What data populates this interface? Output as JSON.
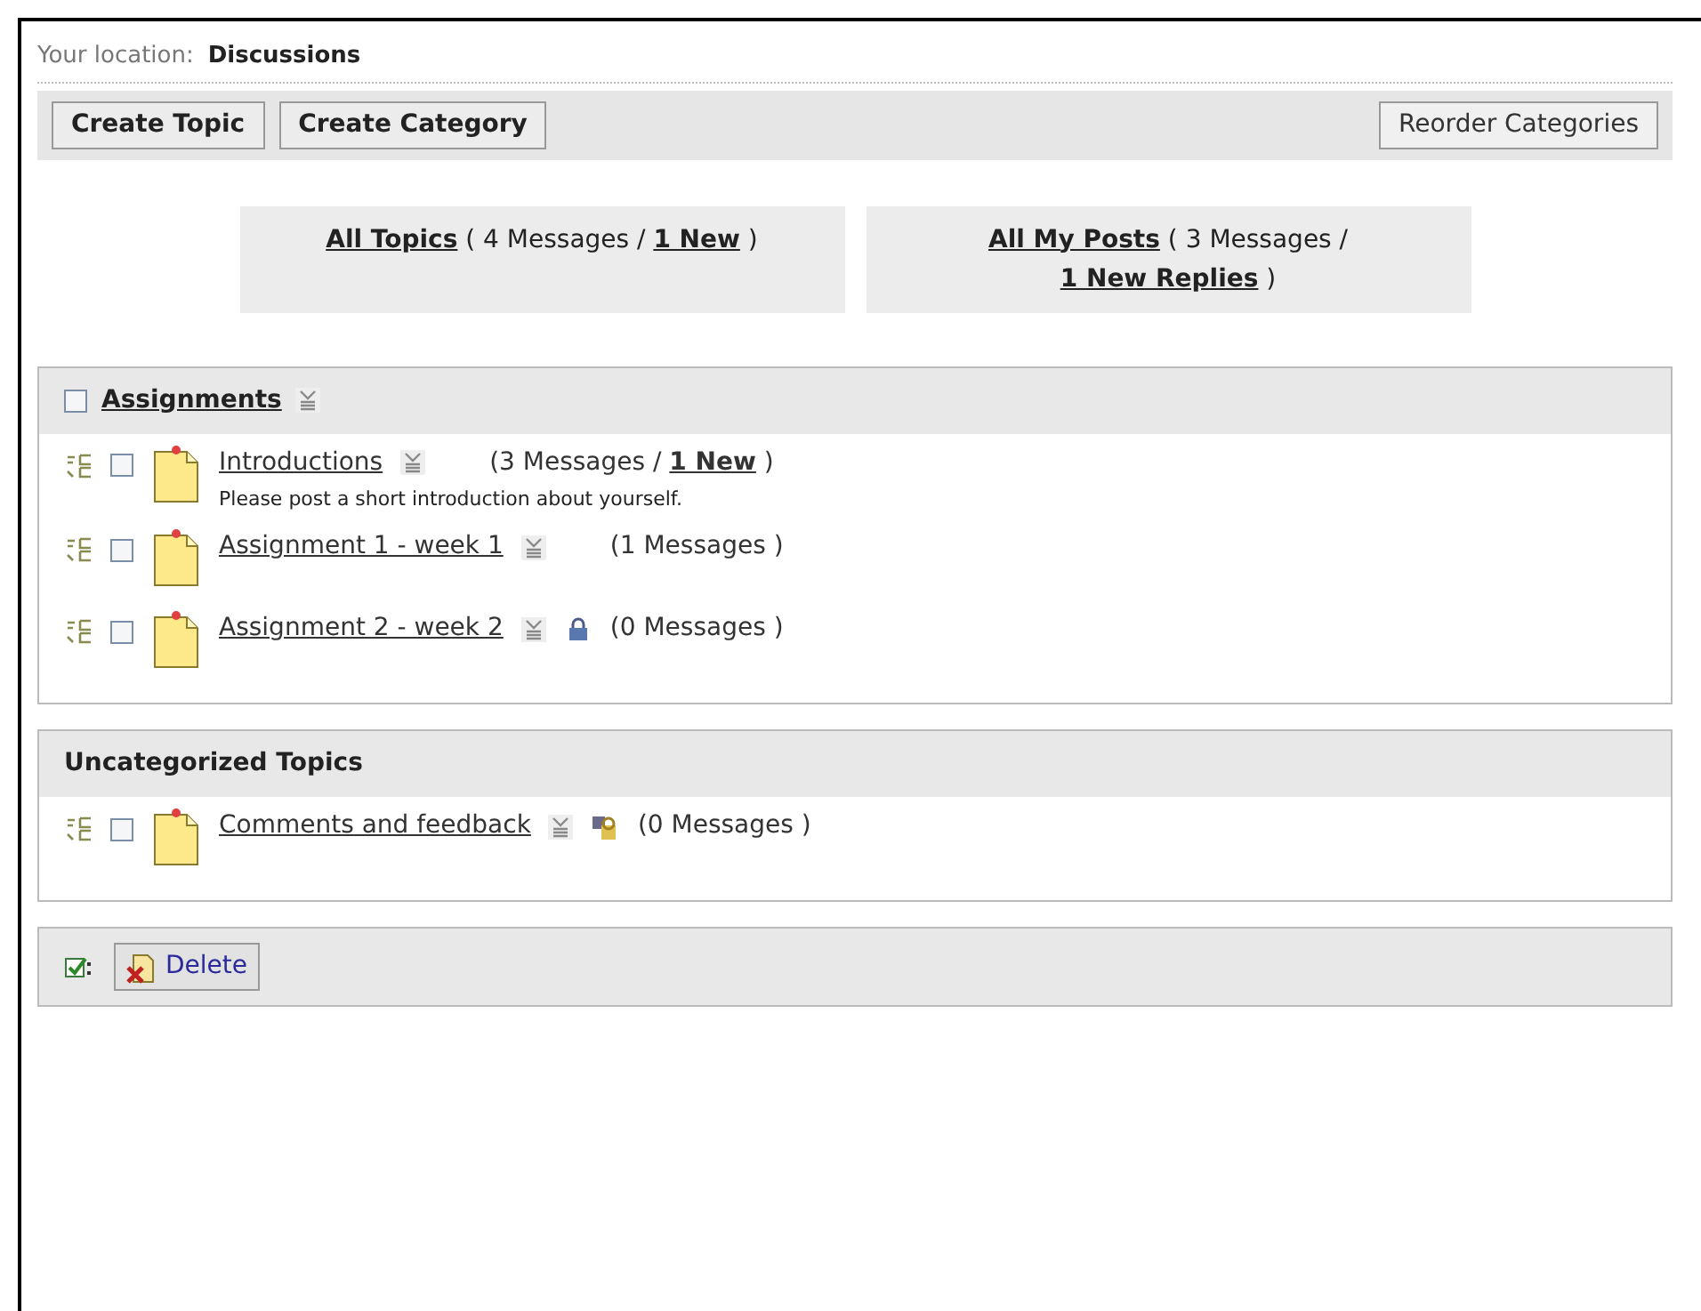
{
  "breadcrumb": {
    "label": "Your location:",
    "current": "Discussions"
  },
  "toolbar": {
    "left_buttons": [
      "Create Topic",
      "Create Category"
    ],
    "right_button": "Reorder Categories"
  },
  "summaries": [
    {
      "link": "All Topics",
      "text": "( 4 Messages /",
      "new_link": "1 New",
      "end": ")"
    },
    {
      "link": "All My Posts",
      "text": "( 3 Messages /",
      "new_link": "1 New Replies",
      "end": ")"
    }
  ],
  "categories": [
    {
      "title": "Assignments",
      "kind": "category",
      "checked": false,
      "topics": [
        {
          "title": "Introductions",
          "kind": "open",
          "checked": false,
          "count": "(3 Messages /",
          "new_link": "1 New",
          "end": ")",
          "description": "Please post a short introduction about yourself."
        },
        {
          "title": "Assignment 1 - week 1",
          "kind": "open",
          "checked": false,
          "count": "(1 Messages )"
        },
        {
          "title": "Assignment 2 - week 2",
          "kind": "locked",
          "checked": false,
          "count": "(0 Messages )"
        }
      ]
    },
    {
      "title": "Uncategorized Topics",
      "kind": "uncategorized",
      "topics": [
        {
          "title": "Comments and feedback",
          "kind": "restricted",
          "checked": false,
          "count": "(0 Messages )"
        }
      ]
    }
  ],
  "footer": {
    "delete_button": "Delete"
  }
}
